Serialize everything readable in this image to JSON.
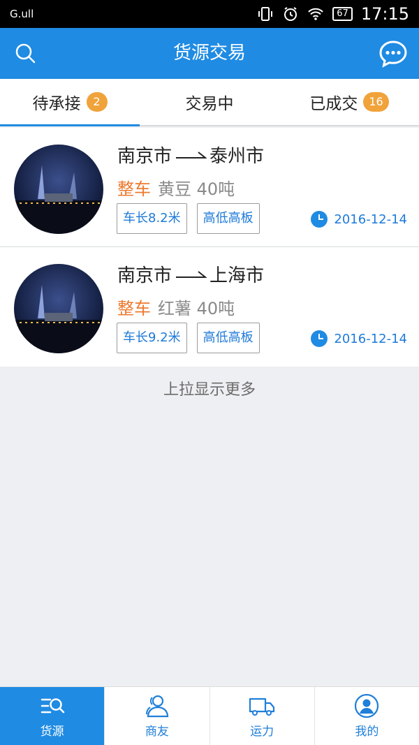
{
  "status_bar": {
    "signal": "G.ull",
    "battery": "67",
    "time": "17:15"
  },
  "header": {
    "title": "货源交易"
  },
  "tabs": [
    {
      "label": "待承接",
      "badge": "2"
    },
    {
      "label": "交易中",
      "badge": ""
    },
    {
      "label": "已成交",
      "badge": "16"
    }
  ],
  "items": [
    {
      "from": "南京市",
      "to": "泰州市",
      "type": "整车",
      "goods": "黄豆 40吨",
      "length": "车长8.2米",
      "truck": "高低高板",
      "date": "2016-12-14"
    },
    {
      "from": "南京市",
      "to": "上海市",
      "type": "整车",
      "goods": "红薯 40吨",
      "length": "车长9.2米",
      "truck": "高低高板",
      "date": "2016-12-14"
    }
  ],
  "load_more": "上拉显示更多",
  "nav": [
    {
      "label": "货源",
      "icon": "list-search-icon"
    },
    {
      "label": "商友",
      "icon": "people-icon"
    },
    {
      "label": "运力",
      "icon": "truck-icon"
    },
    {
      "label": "我的",
      "icon": "person-icon"
    }
  ],
  "colors": {
    "primary": "#1f8be3",
    "badge": "#f0a33b",
    "accent_orange": "#ec7a2e"
  }
}
